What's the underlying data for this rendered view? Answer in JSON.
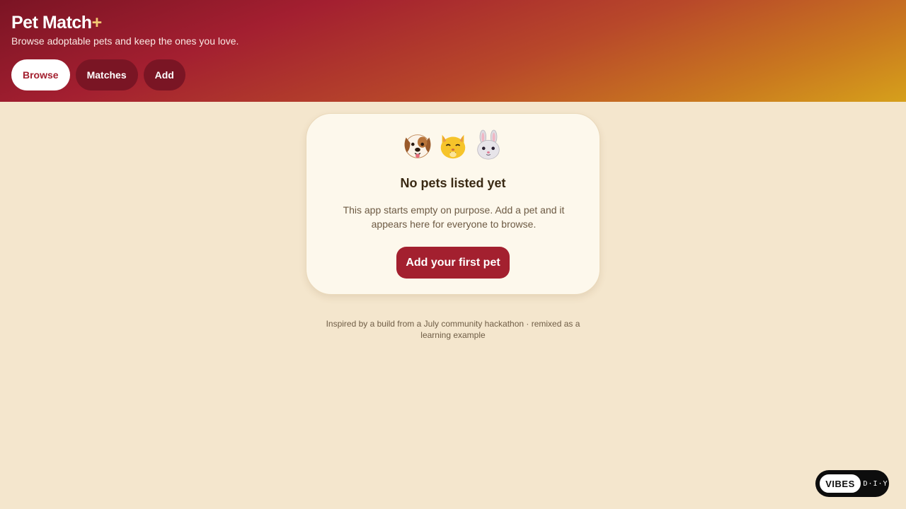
{
  "header": {
    "title": "Pet Match",
    "title_suffix": "+",
    "subtitle": "Browse adoptable pets and keep the ones you love.",
    "colors": {
      "start": "#7b1424",
      "mid": "#a31f30",
      "end": "#d6a01b"
    }
  },
  "nav": {
    "tabs": [
      {
        "label": "Browse",
        "active": true
      },
      {
        "label": "Matches",
        "active": false
      },
      {
        "label": "Add",
        "active": false
      }
    ]
  },
  "empty_state": {
    "icons": [
      "dog-face-icon",
      "cat-face-icon",
      "rabbit-face-icon"
    ],
    "title": "No pets listed yet",
    "description": "This app starts empty on purpose. Add a pet and it appears here for everyone to browse.",
    "cta_label": "Add your first pet"
  },
  "footer": {
    "note": "Inspired by a build from a July community hackathon · remixed as a learning example"
  },
  "badge": {
    "brand": "VIBES",
    "suffix": "D·I·Y"
  },
  "colors": {
    "accent": "#a3202f",
    "background": "#f4e6cd",
    "card": "#fdf8ec"
  }
}
